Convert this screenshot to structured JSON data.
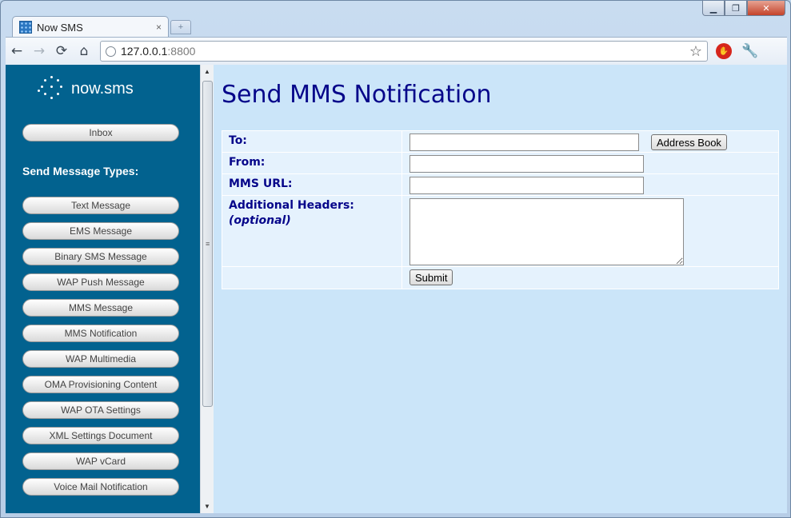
{
  "browser": {
    "tab_title": "Now SMS",
    "tab_close": "×",
    "url_host": "127.0.0.1",
    "url_port": ":8800",
    "icons": {
      "favicon": "nowsms-favicon",
      "back": "←",
      "forward": "→",
      "reload": "⟳",
      "home": "⌂",
      "star": "☆",
      "wrench": "🔧",
      "stop": "✋"
    },
    "caption": {
      "min": "▁",
      "max": "❐",
      "close": "✕"
    }
  },
  "sidebar": {
    "logo_text": "now.sms",
    "inbox_label": "Inbox",
    "section_title": "Send Message Types:",
    "items": [
      "Text Message",
      "EMS Message",
      "Binary SMS Message",
      "WAP Push Message",
      "MMS Message",
      "MMS Notification",
      "WAP Multimedia",
      "OMA Provisioning Content",
      "WAP OTA Settings",
      "XML Settings Document",
      "WAP vCard",
      "Voice Mail Notification"
    ]
  },
  "main": {
    "title": "Send MMS Notification",
    "form": {
      "to_label": "To:",
      "to_value": "",
      "address_book_label": "Address Book",
      "from_label": "From:",
      "from_value": "",
      "mms_url_label": "MMS URL:",
      "mms_url_value": "",
      "headers_label": "Additional Headers:",
      "headers_optional": "(optional)",
      "headers_value": "",
      "submit_label": "Submit"
    }
  },
  "colors": {
    "sidebar_bg": "#02628f",
    "content_bg": "#cbe5f9",
    "title_color": "#06068a"
  }
}
